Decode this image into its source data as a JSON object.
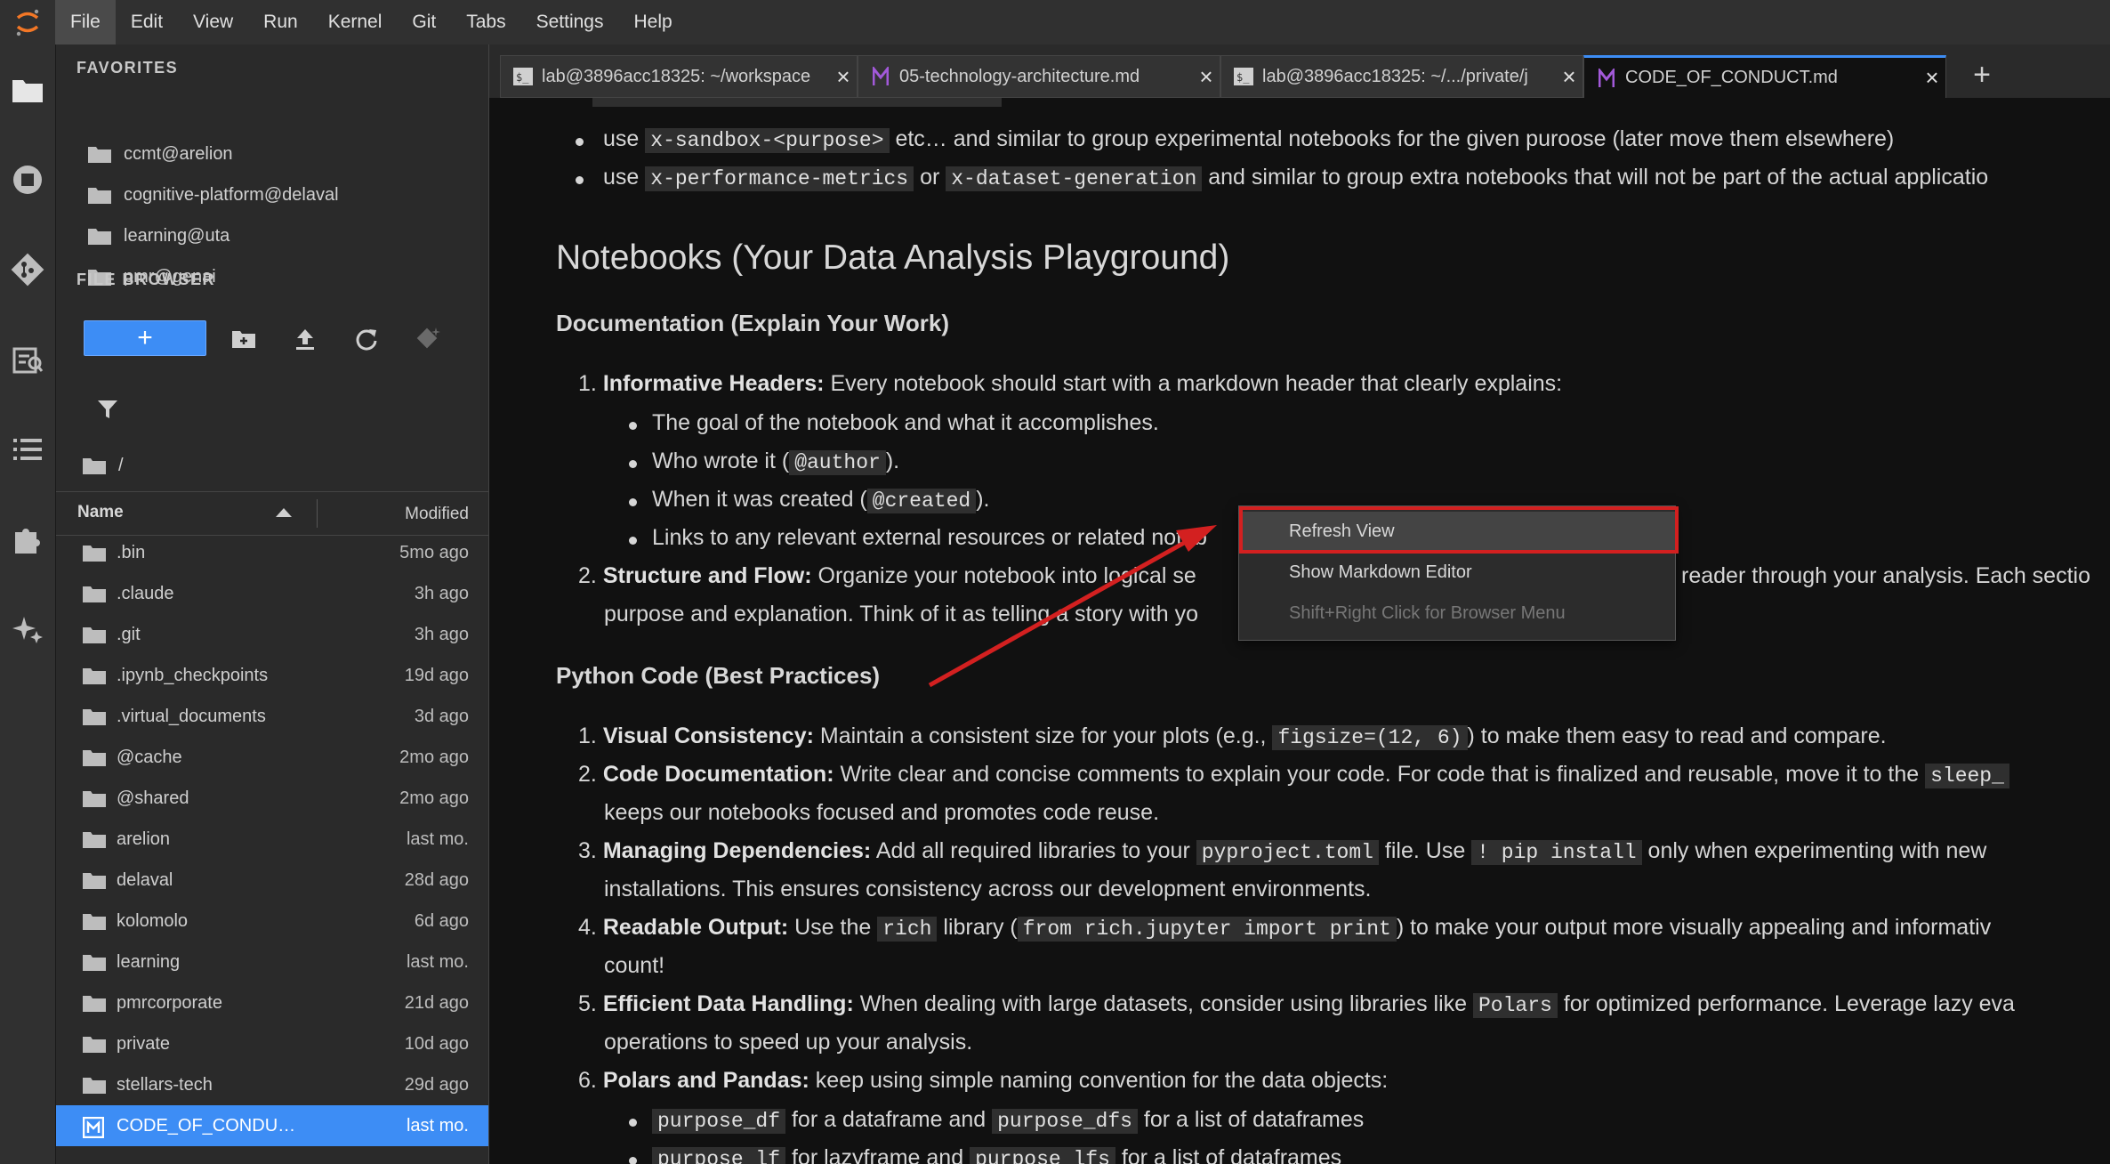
{
  "menubar": {
    "items": [
      "File",
      "Edit",
      "View",
      "Run",
      "Kernel",
      "Git",
      "Tabs",
      "Settings",
      "Help"
    ]
  },
  "activity": {
    "icons": [
      "folder-icon",
      "stop-circle-icon",
      "git-icon",
      "property-inspector-icon",
      "toc-list-icon",
      "extension-icon",
      "ai-sparkle-icon"
    ]
  },
  "favorites": {
    "heading": "FAVORITES",
    "items": [
      "ccmt@arelion",
      "cognitive-platform@delaval",
      "learning@uta",
      "pmr@genai"
    ]
  },
  "file_browser": {
    "heading": "FILE BROWSER",
    "new_label": "+",
    "breadcrumb": "/",
    "columns": {
      "name": "Name",
      "modified": "Modified"
    },
    "files": [
      {
        "name": ".bin",
        "modified": "5mo ago"
      },
      {
        "name": ".claude",
        "modified": "3h ago"
      },
      {
        "name": ".git",
        "modified": "3h ago"
      },
      {
        "name": ".ipynb_checkpoints",
        "modified": "19d ago"
      },
      {
        "name": ".virtual_documents",
        "modified": "3d ago"
      },
      {
        "name": "@cache",
        "modified": "2mo ago"
      },
      {
        "name": "@shared",
        "modified": "2mo ago"
      },
      {
        "name": "arelion",
        "modified": "last mo."
      },
      {
        "name": "delaval",
        "modified": "28d ago"
      },
      {
        "name": "kolomolo",
        "modified": "6d ago"
      },
      {
        "name": "learning",
        "modified": "last mo."
      },
      {
        "name": "pmrcorporate",
        "modified": "21d ago"
      },
      {
        "name": "private",
        "modified": "10d ago"
      },
      {
        "name": "stellars-tech",
        "modified": "29d ago"
      },
      {
        "name": "CODE_OF_CONDU…",
        "modified": "last mo."
      }
    ]
  },
  "tabs": [
    {
      "label": "lab@3896acc18325: ~/workspace",
      "close": "×"
    },
    {
      "label": "05-technology-architecture.md",
      "close": "×"
    },
    {
      "label": "lab@3896acc18325: ~/.../private/j",
      "close": "×"
    },
    {
      "label": "CODE_OF_CONDUCT.md",
      "close": "×"
    }
  ],
  "add_tab": "+",
  "doc": {
    "b1": {
      "pre": "use ",
      "code1": "x-sandbox-<purpose>",
      "post": " etc… and similar to group experimental notebooks for the given puroose (later move them elsewhere)"
    },
    "b2": {
      "pre": "use ",
      "code1": "x-performance-metrics",
      "mid": " or ",
      "code2": "x-dataset-generation",
      "post": " and similar to group extra notebooks that will not be part of the actual applicatio"
    },
    "h_notebooks": "Notebooks (Your Data Analysis Playground)",
    "h_doc": "Documentation (Explain Your Work)",
    "n1": {
      "num": "1.",
      "bold": "Informative Headers:",
      "text": " Every notebook should start with a markdown header that clearly explains:"
    },
    "n1a": "The goal of the notebook and what it accomplishes.",
    "n1b": {
      "pre": "Who wrote it (",
      "code": "@author",
      "post": ")."
    },
    "n1c": {
      "pre": "When it was created (",
      "code": "@created",
      "post": ")."
    },
    "n1d": "Links to any relevant external resources or related noteb",
    "n2": {
      "num": "2.",
      "bold": "Structure and Flow:",
      "text": " Organize your notebook into logical se",
      "tail": "reader through your analysis. Each sectio"
    },
    "n2b": {
      "text": "purpose and explanation. Think of it as telling a story with yo"
    },
    "h_python": "Python Code (Best Practices)",
    "p1": {
      "num": "1.",
      "bold": "Visual Consistency:",
      "pre": " Maintain a consistent size for your plots (e.g., ",
      "code": "figsize=(12, 6)",
      "post": ") to make them easy to read and compare."
    },
    "p2": {
      "num": "2.",
      "bold": "Code Documentation:",
      "pre": " Write clear and concise comments to explain your code. For code that is finalized and reusable, move it to the ",
      "code": "sleep_"
    },
    "p2b": "keeps our notebooks focused and promotes code reuse.",
    "p3": {
      "num": "3.",
      "bold": "Managing Dependencies:",
      "pre": " Add all required libraries to your ",
      "code": "pyproject.toml",
      "mid": " file. Use ",
      "code2": "! pip install",
      "post": " only when experimenting with new"
    },
    "p3b": "installations. This ensures consistency across our development environments.",
    "p4": {
      "num": "4.",
      "bold": "Readable Output:",
      "pre": " Use the ",
      "code": "rich",
      "mid": " library (",
      "code2": "from rich.jupyter import print",
      "post": ") to make your output more visually appealing and informativ"
    },
    "p4b": "count!",
    "p5": {
      "num": "5.",
      "bold": "Efficient Data Handling:",
      "pre": " When dealing with large datasets, consider using libraries like ",
      "code": "Polars",
      "post": " for optimized performance. Leverage lazy eva"
    },
    "p5b": "operations to speed up your analysis.",
    "p6": {
      "num": "6.",
      "bold": "Polars and Pandas:",
      "text": " keep using simple naming convention for the data objects:"
    },
    "p6a": {
      "code": "purpose_df",
      "mid": " for a dataframe and ",
      "code2": "purpose_dfs",
      "post": " for a list of dataframes"
    },
    "p6b": {
      "code": "purpose_lf",
      "mid": " for lazyframe and ",
      "code2": "purpose_lfs",
      "post": " for a list of dataframes"
    }
  },
  "context_menu": {
    "items": [
      "Refresh View",
      "Show Markdown Editor",
      "Shift+Right Click for Browser Menu"
    ]
  },
  "colors": {
    "accent": "#3d8df5",
    "annotation": "#d32020"
  }
}
